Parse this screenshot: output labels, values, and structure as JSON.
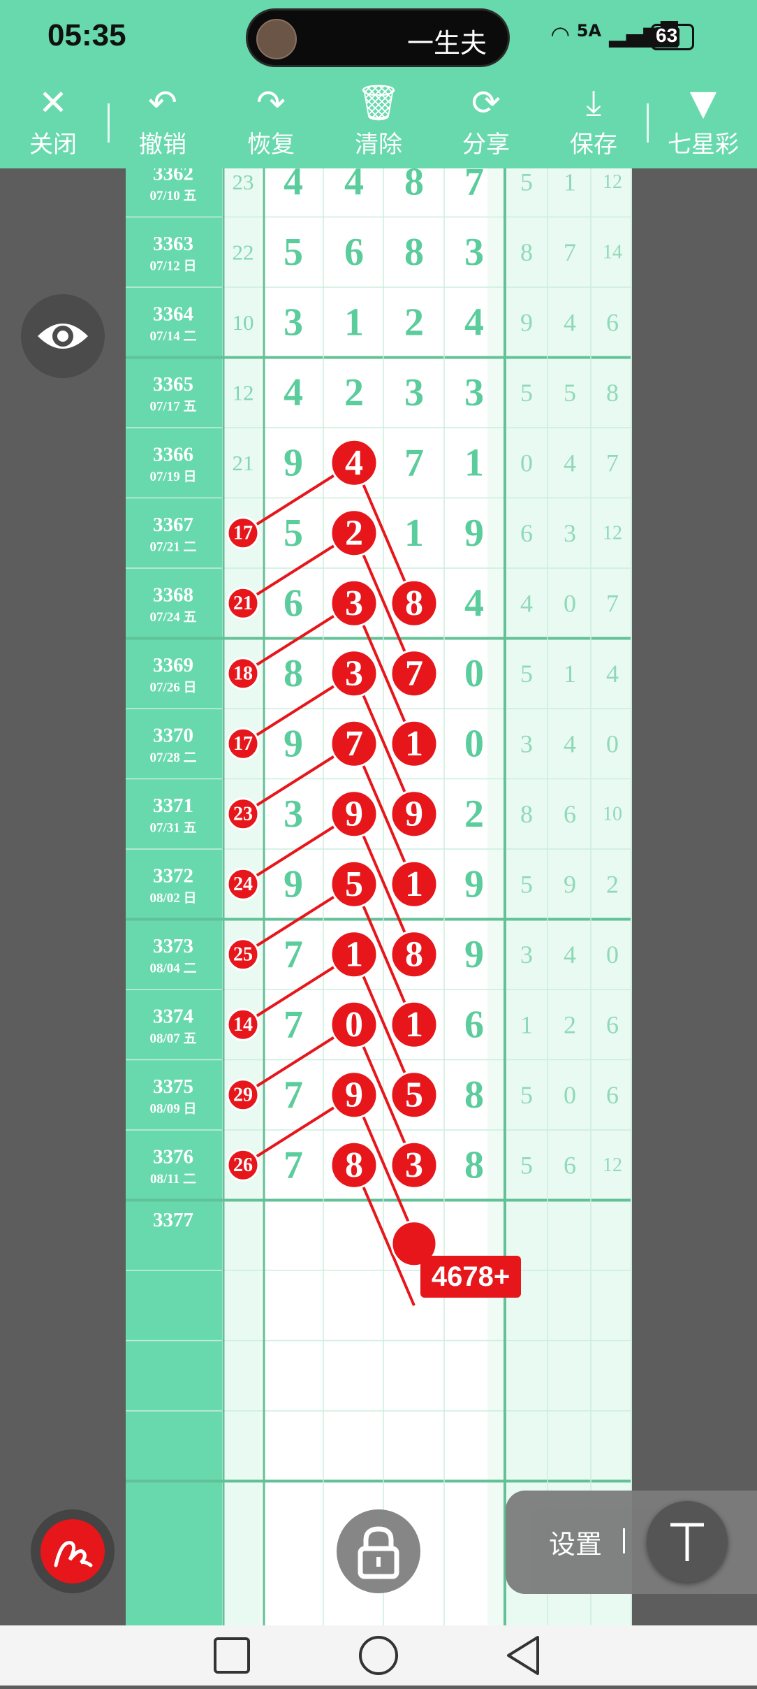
{
  "status_bar": {
    "time": "05:35",
    "island_text": "一生夫",
    "network": "5A",
    "battery": "63"
  },
  "toolbar": {
    "close": "关闭",
    "undo": "撤销",
    "redo": "恢复",
    "clear": "清除",
    "share": "分享",
    "save": "保存",
    "lottery": "七星彩"
  },
  "colors": {
    "header_green": "#67d9ad",
    "digit_green": "#5bcc9b",
    "mark_red": "#e6161b",
    "grid_line": "#62c197"
  },
  "rows": [
    {
      "issue": "3362",
      "date": "07/10 五",
      "s": "23",
      "d": [
        "4",
        "4",
        "8",
        "7"
      ],
      "e": [
        "5",
        "1",
        "12"
      ]
    },
    {
      "issue": "3363",
      "date": "07/12 日",
      "s": "22",
      "d": [
        "5",
        "6",
        "8",
        "3"
      ],
      "e": [
        "8",
        "7",
        "14"
      ]
    },
    {
      "issue": "3364",
      "date": "07/14 二",
      "s": "10",
      "d": [
        "3",
        "1",
        "2",
        "4"
      ],
      "e": [
        "9",
        "4",
        "6"
      ]
    },
    {
      "issue": "3365",
      "date": "07/17 五",
      "s": "12",
      "d": [
        "4",
        "2",
        "3",
        "3"
      ],
      "e": [
        "5",
        "5",
        "8"
      ]
    },
    {
      "issue": "3366",
      "date": "07/19 日",
      "s": "21",
      "d": [
        "9",
        "4",
        "7",
        "1"
      ],
      "e": [
        "0",
        "4",
        "7"
      ]
    },
    {
      "issue": "3367",
      "date": "07/21 二",
      "s": "17",
      "d": [
        "5",
        "2",
        "1",
        "9"
      ],
      "e": [
        "6",
        "3",
        "12"
      ]
    },
    {
      "issue": "3368",
      "date": "07/24 五",
      "s": "21",
      "d": [
        "6",
        "3",
        "8",
        "4"
      ],
      "e": [
        "4",
        "0",
        "7"
      ]
    },
    {
      "issue": "3369",
      "date": "07/26 日",
      "s": "18",
      "d": [
        "8",
        "3",
        "7",
        "0"
      ],
      "e": [
        "5",
        "1",
        "4"
      ]
    },
    {
      "issue": "3370",
      "date": "07/28 二",
      "s": "17",
      "d": [
        "9",
        "7",
        "1",
        "0"
      ],
      "e": [
        "3",
        "4",
        "0"
      ]
    },
    {
      "issue": "3371",
      "date": "07/31 五",
      "s": "23",
      "d": [
        "3",
        "9",
        "9",
        "2"
      ],
      "e": [
        "8",
        "6",
        "10"
      ]
    },
    {
      "issue": "3372",
      "date": "08/02 日",
      "s": "24",
      "d": [
        "9",
        "5",
        "1",
        "9"
      ],
      "e": [
        "5",
        "9",
        "2"
      ]
    },
    {
      "issue": "3373",
      "date": "08/04 二",
      "s": "25",
      "d": [
        "7",
        "1",
        "8",
        "9"
      ],
      "e": [
        "3",
        "4",
        "0"
      ]
    },
    {
      "issue": "3374",
      "date": "08/07 五",
      "s": "14",
      "d": [
        "7",
        "0",
        "1",
        "6"
      ],
      "e": [
        "1",
        "2",
        "6"
      ]
    },
    {
      "issue": "3375",
      "date": "08/09 日",
      "s": "29",
      "d": [
        "7",
        "9",
        "5",
        "8"
      ],
      "e": [
        "5",
        "0",
        "6"
      ]
    },
    {
      "issue": "3376",
      "date": "08/11 二",
      "s": "26",
      "d": [
        "7",
        "8",
        "3",
        "8"
      ],
      "e": [
        "5",
        "6",
        "12"
      ]
    },
    {
      "issue": "3377",
      "date": "",
      "s": "",
      "d": [
        "",
        "",
        "",
        ""
      ],
      "e": [
        "",
        "",
        ""
      ]
    }
  ],
  "marks": {
    "col0": [
      4,
      5,
      6,
      7,
      8,
      9,
      10,
      11,
      12,
      13,
      14
    ],
    "col2": [
      5,
      6,
      7,
      8,
      9,
      10,
      11,
      12,
      13,
      14
    ],
    "col3": [
      6,
      7,
      8,
      9,
      10,
      11,
      12,
      13,
      14
    ]
  },
  "badge": "4678+",
  "settings": "设置"
}
